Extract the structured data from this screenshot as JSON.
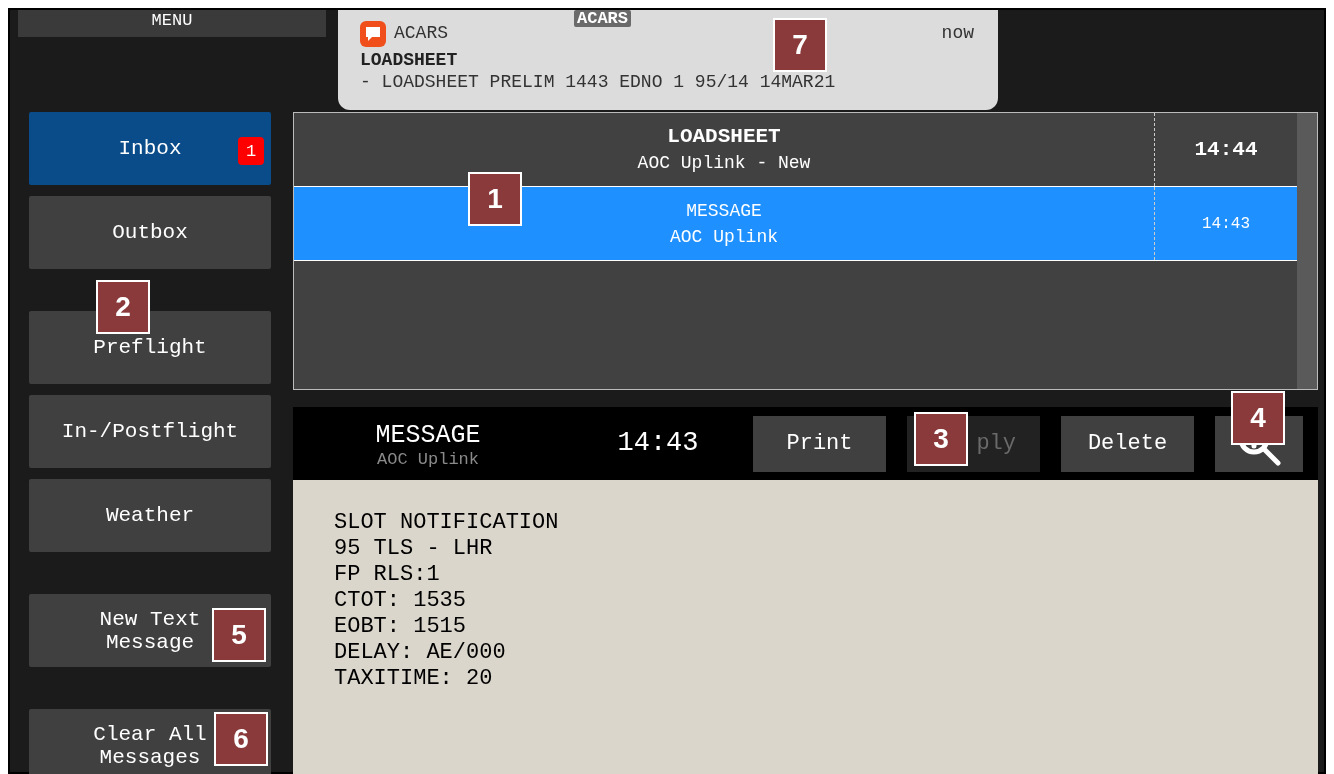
{
  "menu_button": "MENU",
  "header_title": "ACARS",
  "notification": {
    "app": "ACARS",
    "time": "now",
    "title": "LOADSHEET",
    "body": "- LOADSHEET PRELIM 1443 EDNO 1 95/14 14MAR21"
  },
  "sidebar": {
    "groups": [
      [
        {
          "label": "Inbox",
          "selected": true,
          "badge": "1"
        },
        {
          "label": "Outbox",
          "selected": false
        }
      ],
      [
        {
          "label": "Preflight",
          "selected": false
        },
        {
          "label": "In-/Postflight",
          "selected": false
        },
        {
          "label": "Weather",
          "selected": false
        }
      ],
      [
        {
          "label": "New Text Message",
          "selected": false
        }
      ],
      [
        {
          "label": "Clear All Messages",
          "selected": false
        }
      ]
    ]
  },
  "message_list": {
    "rows": [
      {
        "title": "LOADSHEET",
        "subtitle": "AOC Uplink - New",
        "time": "14:44",
        "unread": true,
        "selected": false
      },
      {
        "title": "MESSAGE",
        "subtitle": "AOC Uplink",
        "time": "14:43",
        "unread": false,
        "selected": true
      }
    ]
  },
  "message_view": {
    "title": "MESSAGE",
    "subtitle": "AOC Uplink",
    "time": "14:43",
    "buttons": [
      {
        "kind": "text",
        "label": "Print",
        "disabled": false
      },
      {
        "kind": "text",
        "label": "ply",
        "disabled": true
      },
      {
        "kind": "text",
        "label": "Delete",
        "disabled": false
      },
      {
        "kind": "zoom",
        "disabled": false
      }
    ],
    "body_lines": [
      "SLOT NOTIFICATION",
      "95 TLS - LHR",
      "FP RLS:1",
      "CTOT: 1535",
      "EOBT: 1515",
      "DELAY: AE/000",
      "TAXITIME: 20"
    ]
  },
  "callouts": [
    "1",
    "2",
    "3",
    "4",
    "5",
    "6",
    "7"
  ]
}
